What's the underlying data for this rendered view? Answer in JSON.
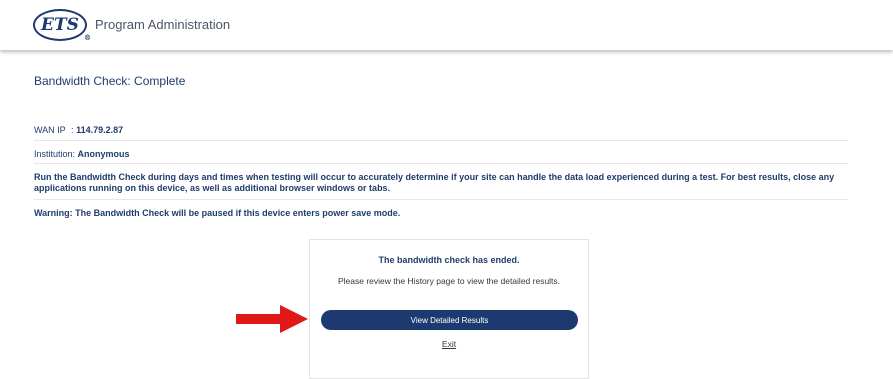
{
  "header": {
    "logo_text": "ETS",
    "logo_mark": "®",
    "app_title": "Program Administration"
  },
  "page_title": "Bandwidth Check: Complete",
  "info": {
    "wan_ip_label": "WAN IP",
    "wan_ip_sep": ":",
    "wan_ip_value": "114.79.2.87",
    "institution_label": "Institution:",
    "institution_value": "Anonymous",
    "instructions": "Run the Bandwidth Check during days and times when testing will occur to accurately determine if your site can handle the data load experienced during a test. For best results, close any applications running on this device, as well as additional browser windows or tabs.",
    "warning": "Warning: The Bandwidth Check will be paused if this device enters power save mode."
  },
  "card": {
    "title": "The bandwidth check has ended.",
    "message": "Please review the History page to view the detailed results.",
    "view_results_label": "View Detailed Results",
    "exit_label": "Exit"
  },
  "colors": {
    "brand_navy": "#1d3a70",
    "arrow_red": "#e01818",
    "text_blue": "#1f3d6b"
  },
  "icons": {
    "logo": "ets-logo",
    "annotation": "red-arrow-icon"
  }
}
